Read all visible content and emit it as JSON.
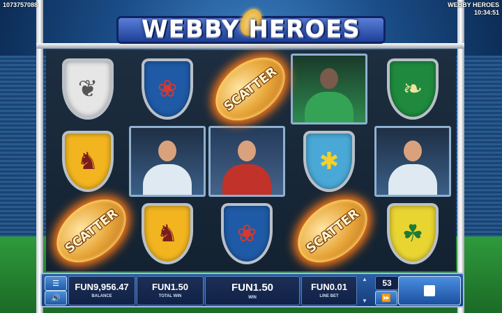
{
  "header": {
    "session_id": "1073757088",
    "game_name": "WEBBY HEROES",
    "clock": "10:34:51",
    "logo_text": "WEBBY HEROES"
  },
  "reels": {
    "scatter_label": "SCATTER"
  },
  "bottom_bar": {
    "menu_icon": "hamburger-icon",
    "sound_icon": "speaker-icon",
    "balance_value": "FUN9,956.47",
    "balance_label": "BALANCE",
    "total_win_value": "FUN1.50",
    "total_win_label": "TOTAL WIN",
    "win_value": "FUN1.50",
    "win_label": "WIN",
    "line_bet_value": "FUN0.01",
    "line_bet_label": "LINE BET",
    "lines_value": "53",
    "autoplay_icon": "fast-forward-icon",
    "spin_icon": "stop-square-icon"
  },
  "colors": {
    "bar": "#1c4f9f",
    "panel": "#112147",
    "scatter_glow": "#ff7a18"
  }
}
